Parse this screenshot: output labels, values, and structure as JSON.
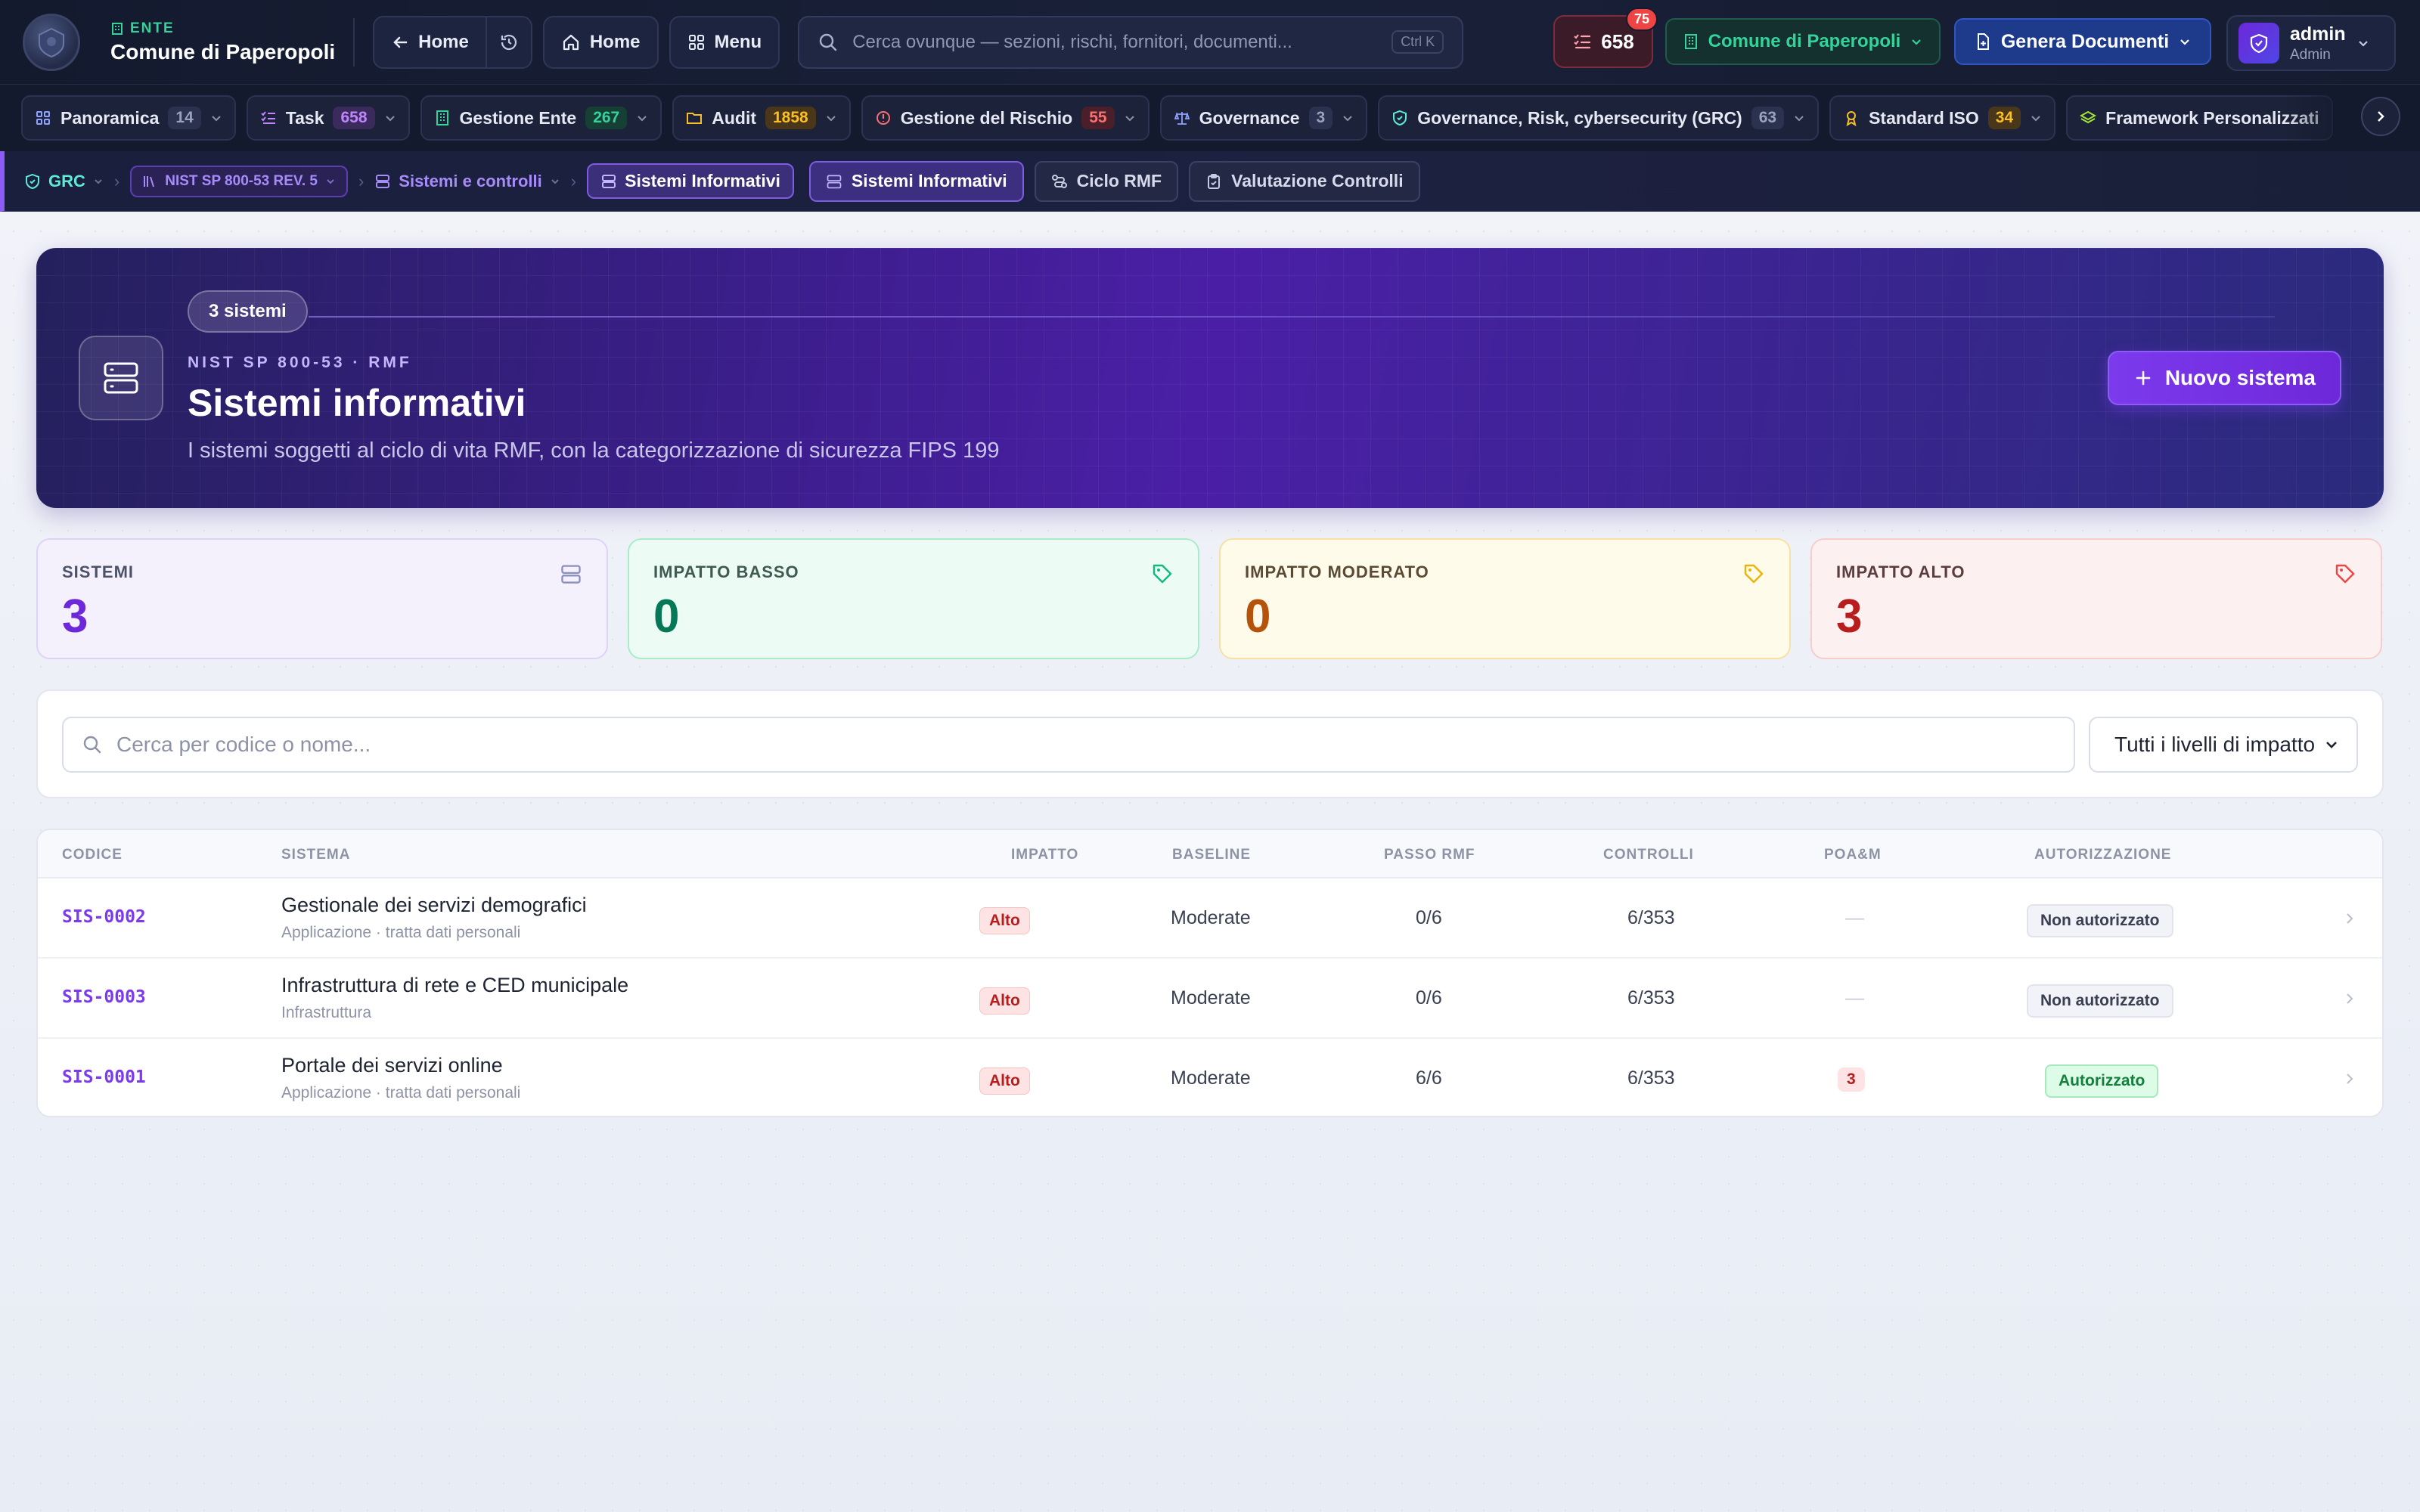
{
  "topbar": {
    "ente_tag": "ENTE",
    "ente_name": "Comune di Paperopoli",
    "back_label": "Home",
    "home_label": "Home",
    "menu_label": "Menu",
    "search_placeholder": "Cerca ovunque — sezioni, rischi, fornitori, documenti...",
    "search_shortcut": "Ctrl K",
    "tasks_count": "658",
    "tasks_notif": "75",
    "org_label": "Comune di Paperopoli",
    "generate_label": "Genera Documenti",
    "user_name": "admin",
    "user_role": "Admin"
  },
  "modules": [
    {
      "label": "Panoramica",
      "count": "14",
      "color": "#9aa3bd",
      "bg": "#2a3250",
      "icon": "grid-icon"
    },
    {
      "label": "Task",
      "count": "658",
      "color": "#c084fc",
      "bg": "#3b2a5c",
      "icon": "list-check-icon"
    },
    {
      "label": "Gestione Ente",
      "count": "267",
      "color": "#34d399",
      "bg": "#163f36",
      "icon": "building-icon"
    },
    {
      "label": "Audit",
      "count": "1858",
      "color": "#fbbf24",
      "bg": "#4a3618",
      "icon": "folder-icon"
    },
    {
      "label": "Gestione del Rischio",
      "count": "55",
      "color": "#f87171",
      "bg": "#4a1f2a",
      "icon": "alert-icon"
    },
    {
      "label": "Governance",
      "count": "3",
      "color": "#9aa3bd",
      "bg": "#2a3250",
      "icon": "scale-icon"
    },
    {
      "label": "Governance, Risk, cybersecurity (GRC)",
      "count": "63",
      "color": "#9aa3bd",
      "bg": "#2a3250",
      "icon": "shield-icon"
    },
    {
      "label": "Standard ISO",
      "count": "34",
      "color": "#fbbf24",
      "bg": "#4a3618",
      "icon": "award-icon"
    },
    {
      "label": "Framework Personalizzati",
      "count": "",
      "color": "#9aa3bd",
      "bg": "#2a3250",
      "icon": "layers-icon"
    }
  ],
  "breadcrumb": {
    "root": "GRC",
    "framework": "NIST SP 800-53 REV. 5",
    "section": "Sistemi e controlli",
    "current": "Sistemi Informativi"
  },
  "subtabs": [
    {
      "label": "Sistemi Informativi",
      "active": true,
      "icon": "server-icon"
    },
    {
      "label": "Ciclo RMF",
      "active": false,
      "icon": "route-icon"
    },
    {
      "label": "Valutazione Controlli",
      "active": false,
      "icon": "clipboard-icon"
    }
  ],
  "hero": {
    "count_label": "3 sistemi",
    "kicker": "NIST SP 800-53 · RMF",
    "title": "Sistemi informativi",
    "subtitle": "I sistemi soggetti al ciclo di vita RMF, con la categorizzazione di sicurezza FIPS 199",
    "new_button": "Nuovo sistema"
  },
  "stats": [
    {
      "label": "SISTEMI",
      "value": "3",
      "color": "#6d28d9",
      "label_color": "#4b5166",
      "bg": "#f4f1fd",
      "border": "#ddd3f7",
      "icon": "server-icon"
    },
    {
      "label": "IMPATTO BASSO",
      "value": "0",
      "color": "#047857",
      "label_color": "#3f5a52",
      "bg": "#ecfbf4",
      "border": "#a9ecc9",
      "icon": "tag-icon"
    },
    {
      "label": "IMPATTO MODERATO",
      "value": "0",
      "color": "#b45309",
      "label_color": "#5a4a33",
      "bg": "#fffbea",
      "border": "#f8e1a0",
      "icon": "tag-icon"
    },
    {
      "label": "IMPATTO ALTO",
      "value": "3",
      "color": "#b91c1c",
      "label_color": "#5a3d3d",
      "bg": "#fdf0f0",
      "border": "#f6cccc",
      "icon": "tag-icon"
    }
  ],
  "filter": {
    "search_placeholder": "Cerca per codice o nome...",
    "impact_select": "Tutti i livelli di impatto"
  },
  "table": {
    "headers": [
      "CODICE",
      "SISTEMA",
      "IMPATTO",
      "BASELINE",
      "PASSO RMF",
      "CONTROLLI",
      "POA&M",
      "AUTORIZZAZIONE"
    ],
    "rows": [
      {
        "code": "SIS-0002",
        "name": "Gestionale dei servizi demografici",
        "sub": "Applicazione · tratta dati personali",
        "impact": "Alto",
        "baseline": "Moderate",
        "rmf": "0/6",
        "controls": "6/353",
        "poam": "—",
        "auth": "Non autorizzato",
        "authorized": false
      },
      {
        "code": "SIS-0003",
        "name": "Infrastruttura di rete e CED municipale",
        "sub": "Infrastruttura",
        "impact": "Alto",
        "baseline": "Moderate",
        "rmf": "0/6",
        "controls": "6/353",
        "poam": "—",
        "auth": "Non autorizzato",
        "authorized": false
      },
      {
        "code": "SIS-0001",
        "name": "Portale dei servizi online",
        "sub": "Applicazione · tratta dati personali",
        "impact": "Alto",
        "baseline": "Moderate",
        "rmf": "6/6",
        "controls": "6/353",
        "poam": "3",
        "auth": "Autorizzato",
        "authorized": true
      }
    ]
  }
}
